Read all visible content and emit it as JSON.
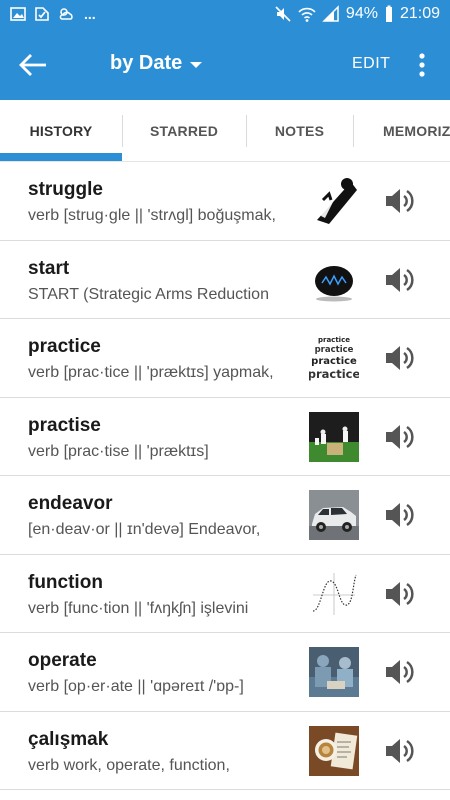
{
  "status_bar": {
    "dots": "...",
    "battery": "94%",
    "time": "21:09"
  },
  "app_bar": {
    "title": "by Date",
    "edit_label": "EDIT",
    "color": "#2c8fd6"
  },
  "tabs": [
    {
      "label": "HISTORY",
      "selected": true
    },
    {
      "label": "STARRED",
      "selected": false
    },
    {
      "label": "NOTES",
      "selected": false
    },
    {
      "label": "MEMORIZ",
      "selected": false
    }
  ],
  "entries": [
    {
      "word": "struggle",
      "desc": "verb [strug·gle || 'strʌgl] boğuşmak,",
      "image": "struggle-picture"
    },
    {
      "word": "start",
      "desc": "START (Strategic Arms Reduction",
      "image": "start-logo-picture"
    },
    {
      "word": "practice",
      "desc": "verb [prac·tice || 'præktɪs] yapmak,",
      "image": "practice-text-picture",
      "image_text": "practice"
    },
    {
      "word": "practise",
      "desc": "verb [prac·tise || 'præktɪs]",
      "image": "cricket-picture"
    },
    {
      "word": "endeavor",
      "desc": "[en·deav·or || ɪn'devə] Endeavor,",
      "image": "car-picture"
    },
    {
      "word": "function",
      "desc": "verb [func·tion || 'fʌŋkʃn] işlevini",
      "image": "function-graph-picture"
    },
    {
      "word": "operate",
      "desc": "verb [op·er·ate || 'ɑpəreɪt /'ɒp-]",
      "image": "surgery-picture"
    },
    {
      "word": "çalışmak",
      "desc": "verb work, operate, function,",
      "image": "coffee-picture"
    }
  ]
}
